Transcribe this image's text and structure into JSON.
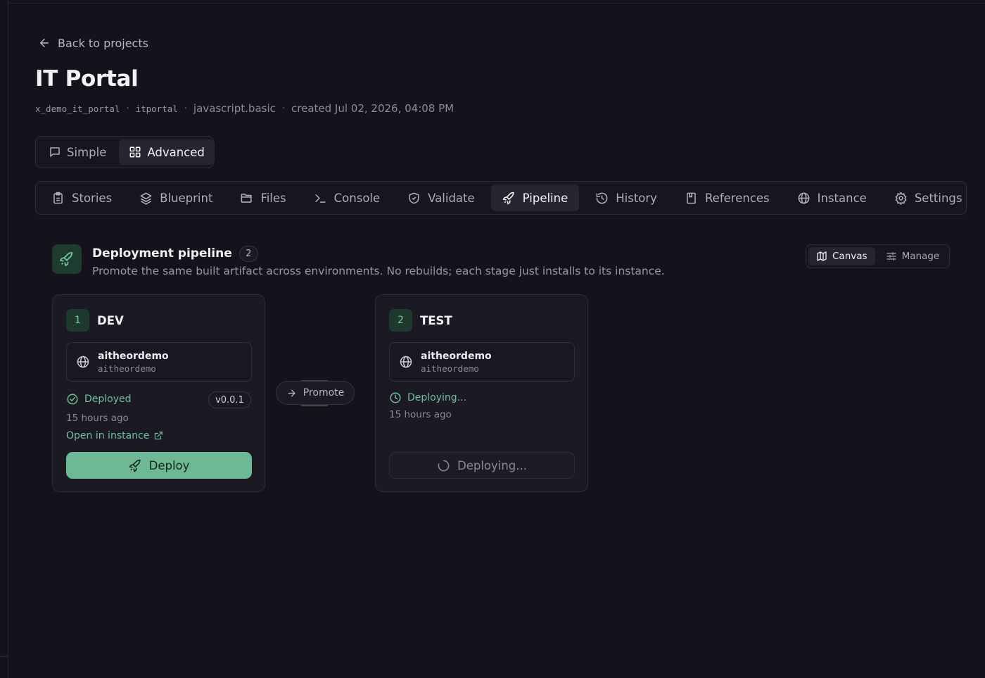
{
  "nav": {
    "back_label": "Back to projects"
  },
  "project": {
    "title": "IT Portal",
    "scope": "x_demo_it_portal",
    "slug": "itportal",
    "template": "javascript.basic",
    "created": "created Jul 02, 2026, 04:08 PM",
    "separator": "·"
  },
  "mode": {
    "options": [
      {
        "label": "Simple",
        "icon": "chat-icon",
        "active": false
      },
      {
        "label": "Advanced",
        "icon": "grid-icon",
        "active": true
      }
    ]
  },
  "tabs": [
    {
      "label": "Stories",
      "icon": "clipboard-icon",
      "active": false
    },
    {
      "label": "Blueprint",
      "icon": "layers-icon",
      "active": false
    },
    {
      "label": "Files",
      "icon": "folder-icon",
      "active": false
    },
    {
      "label": "Console",
      "icon": "terminal-icon",
      "active": false
    },
    {
      "label": "Validate",
      "icon": "shield-check-icon",
      "active": false
    },
    {
      "label": "Pipeline",
      "icon": "rocket-icon",
      "active": true
    },
    {
      "label": "History",
      "icon": "history-icon",
      "active": false
    },
    {
      "label": "References",
      "icon": "bookmark-icon",
      "active": false
    },
    {
      "label": "Instance",
      "icon": "globe-icon",
      "active": false
    },
    {
      "label": "Settings",
      "icon": "gear-icon",
      "active": false
    }
  ],
  "pipeline": {
    "title": "Deployment pipeline",
    "count": "2",
    "description": "Promote the same built artifact across environments. No rebuilds; each stage just installs to its instance.",
    "views": [
      {
        "label": "Canvas",
        "icon": "map-icon",
        "active": true
      },
      {
        "label": "Manage",
        "icon": "sliders-icon",
        "active": false
      }
    ],
    "promote_label": "Promote",
    "stages": [
      {
        "number": "1",
        "name": "DEV",
        "instance_name": "aitheordemo",
        "instance_host": "aitheordemo",
        "status": "Deployed",
        "version": "v0.0.1",
        "time_ago": "15 hours ago",
        "open_link": "Open in instance",
        "action_label": "Deploy"
      },
      {
        "number": "2",
        "name": "TEST",
        "instance_name": "aitheordemo",
        "instance_host": "aitheordemo",
        "status": "Deploying...",
        "time_ago": "15 hours ago",
        "action_label": "Deploying..."
      }
    ]
  },
  "colors": {
    "background": "#14131b",
    "accent": "#6cc39a",
    "primary_button": "#6db895",
    "card": "#1b1a23"
  }
}
